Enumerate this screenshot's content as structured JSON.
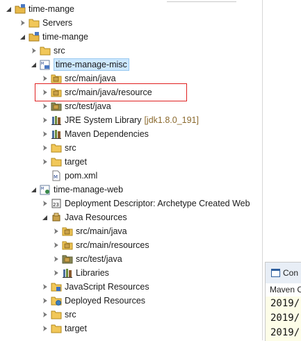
{
  "project_explorer": {
    "rows": [
      {
        "label": "time-mange"
      },
      {
        "label": "Servers"
      },
      {
        "label": "time-mange"
      },
      {
        "label": "src"
      },
      {
        "label": "time-manage-misc"
      },
      {
        "label": "src/main/java"
      },
      {
        "label": "src/main/java/resource"
      },
      {
        "label": "src/test/java"
      },
      {
        "label": "JRE System Library",
        "decoration": "[jdk1.8.0_191]"
      },
      {
        "label": "Maven Dependencies"
      },
      {
        "label": "src"
      },
      {
        "label": "target"
      },
      {
        "label": "pom.xml"
      },
      {
        "label": "time-manage-web"
      },
      {
        "label": "Deployment Descriptor: Archetype Created Web"
      },
      {
        "label": "Java Resources"
      },
      {
        "label": "src/main/java"
      },
      {
        "label": "src/main/resources"
      },
      {
        "label": "src/test/java"
      },
      {
        "label": "Libraries"
      },
      {
        "label": "JavaScript Resources"
      },
      {
        "label": "Deployed Resources"
      },
      {
        "label": "src"
      },
      {
        "label": "target"
      }
    ]
  },
  "console": {
    "tab_label": "Console",
    "tab_label_visible": "Con",
    "sub_label": "Maven C",
    "lines": [
      "2019/",
      "2019/",
      "2019/"
    ]
  },
  "colors": {
    "highlight_border": "#e02020",
    "selection_bg": "#cde8ff",
    "decoration_text": "#8b6a2e",
    "console_bg": "#fdfde8"
  }
}
